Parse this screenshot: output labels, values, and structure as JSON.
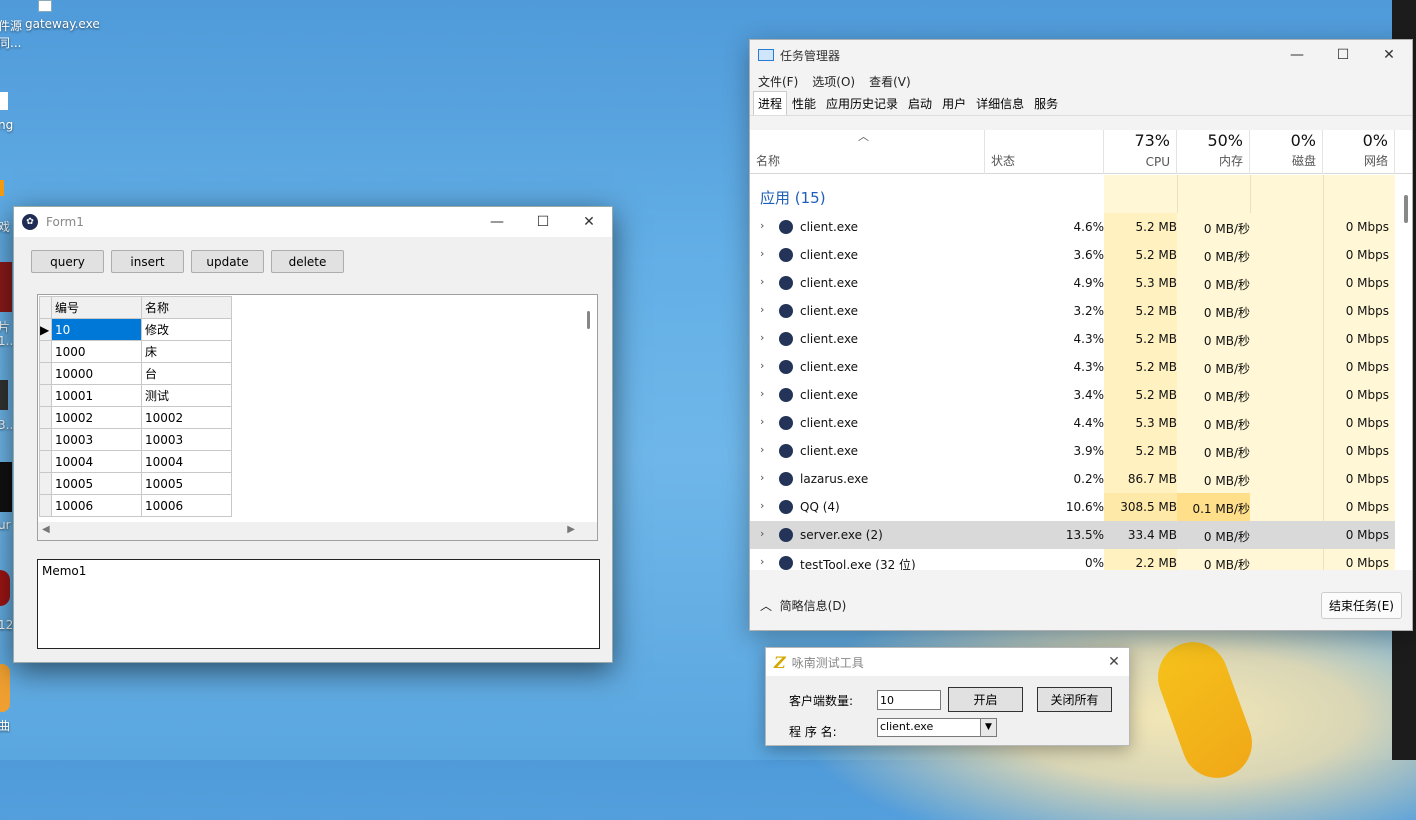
{
  "desktop": {
    "icon_labels": [
      "gateway.exe",
      "件源",
      "同...",
      "ng",
      "戏",
      "片",
      "1...",
      "3...",
      "ur",
      "12",
      "曲"
    ]
  },
  "form1": {
    "title": "Form1",
    "buttons": {
      "query": "query",
      "insert": "insert",
      "update": "update",
      "delete": "delete"
    },
    "grid": {
      "headers": [
        "编号",
        "名称"
      ],
      "rows": [
        [
          "10",
          "修改"
        ],
        [
          "1000",
          "床"
        ],
        [
          "10000",
          "台"
        ],
        [
          "10001",
          "测试"
        ],
        [
          "10002",
          "10002"
        ],
        [
          "10003",
          "10003"
        ],
        [
          "10004",
          "10004"
        ],
        [
          "10005",
          "10005"
        ],
        [
          "10006",
          "10006"
        ]
      ]
    },
    "memo": "Memo1"
  },
  "task_manager": {
    "title": "任务管理器",
    "menu": [
      "文件(F)",
      "选项(O)",
      "查看(V)"
    ],
    "tabs": [
      "进程",
      "性能",
      "应用历史记录",
      "启动",
      "用户",
      "详细信息",
      "服务"
    ],
    "columns": {
      "name": "名称",
      "status": "状态",
      "cpu_pct": "73%",
      "cpu": "CPU",
      "mem_pct": "50%",
      "mem": "内存",
      "disk_pct": "0%",
      "disk": "磁盘",
      "net_pct": "0%",
      "net": "网络"
    },
    "group": "应用 (15)",
    "processes": [
      {
        "name": "client.exe",
        "cpu": "4.6%",
        "mem": "5.2 MB",
        "disk": "0 MB/秒",
        "net": "0 Mbps"
      },
      {
        "name": "client.exe",
        "cpu": "3.6%",
        "mem": "5.2 MB",
        "disk": "0 MB/秒",
        "net": "0 Mbps"
      },
      {
        "name": "client.exe",
        "cpu": "4.9%",
        "mem": "5.3 MB",
        "disk": "0 MB/秒",
        "net": "0 Mbps"
      },
      {
        "name": "client.exe",
        "cpu": "3.2%",
        "mem": "5.2 MB",
        "disk": "0 MB/秒",
        "net": "0 Mbps"
      },
      {
        "name": "client.exe",
        "cpu": "4.3%",
        "mem": "5.2 MB",
        "disk": "0 MB/秒",
        "net": "0 Mbps"
      },
      {
        "name": "client.exe",
        "cpu": "4.3%",
        "mem": "5.2 MB",
        "disk": "0 MB/秒",
        "net": "0 Mbps"
      },
      {
        "name": "client.exe",
        "cpu": "3.4%",
        "mem": "5.2 MB",
        "disk": "0 MB/秒",
        "net": "0 Mbps"
      },
      {
        "name": "client.exe",
        "cpu": "4.4%",
        "mem": "5.3 MB",
        "disk": "0 MB/秒",
        "net": "0 Mbps"
      },
      {
        "name": "client.exe",
        "cpu": "3.9%",
        "mem": "5.2 MB",
        "disk": "0 MB/秒",
        "net": "0 Mbps"
      },
      {
        "name": "lazarus.exe",
        "cpu": "0.2%",
        "mem": "86.7 MB",
        "disk": "0 MB/秒",
        "net": "0 Mbps"
      },
      {
        "name": "QQ (4)",
        "cpu": "10.6%",
        "mem": "308.5 MB",
        "disk": "0.1 MB/秒",
        "net": "0 Mbps"
      },
      {
        "name": "server.exe (2)",
        "cpu": "13.5%",
        "mem": "33.4 MB",
        "disk": "0 MB/秒",
        "net": "0 Mbps"
      },
      {
        "name": "testTool.exe (32 位)",
        "cpu": "0%",
        "mem": "2.2 MB",
        "disk": "0 MB/秒",
        "net": "0 Mbps"
      }
    ],
    "footer": {
      "less_info": "简略信息(D)",
      "end_task": "结束任务(E)"
    }
  },
  "test_tool": {
    "title": "咏南测试工具",
    "client_count_label": "客户端数量:",
    "client_count_value": "10",
    "start_button": "开启",
    "close_all_button": "关闭所有",
    "program_label": "程 序 名:",
    "program_value": "client.exe"
  },
  "colors": {
    "desktop_blue": "#5aa6df",
    "selection_blue": "#0078d7",
    "tm_yellow": "#fff7d6",
    "tm_group_blue": "#1f5fb8"
  }
}
